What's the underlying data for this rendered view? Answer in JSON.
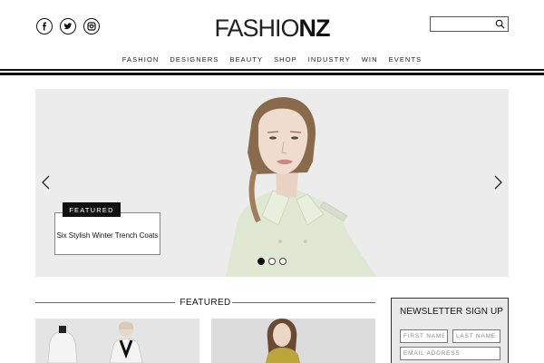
{
  "header": {
    "logo_light": "FASHIO",
    "logo_bold": "NZ",
    "social": [
      {
        "icon": "facebook-icon"
      },
      {
        "icon": "twitter-icon"
      },
      {
        "icon": "instagram-icon"
      }
    ],
    "search": {
      "placeholder": "",
      "value": ""
    }
  },
  "nav": {
    "items": [
      "FASHION",
      "DESIGNERS",
      "BEAUTY",
      "SHOP",
      "INDUSTRY",
      "WIN",
      "EVENTS"
    ]
  },
  "hero": {
    "tag": "FEATURED",
    "title": "Six Stylish Winter Trench Coats",
    "slides": 3,
    "active_slide": 1
  },
  "featured": {
    "heading": "FEATURED"
  },
  "newsletter": {
    "title": "NEWSLETTER SIGN UP",
    "first_name_placeholder": "FIRST NAME",
    "last_name_placeholder": "LAST NAME",
    "email_placeholder": "EMAIL ADDRESS"
  }
}
